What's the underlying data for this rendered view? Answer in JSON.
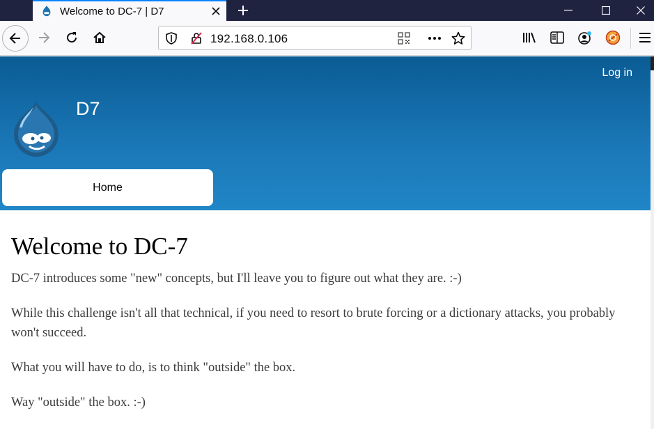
{
  "browser": {
    "tab": {
      "title": "Welcome to DC-7 | D7"
    },
    "url": "192.168.0.106",
    "icons": {
      "back": "arrow-left-icon",
      "forward": "arrow-right-icon",
      "reload": "reload-icon",
      "home": "home-icon",
      "shield": "shield-icon",
      "insecure": "insecure-lock-icon",
      "qr": "qr-code-icon",
      "page_actions": "ellipsis-icon",
      "bookmark": "star-icon",
      "library": "library-icon",
      "sidebar": "sidebar-icon",
      "account": "account-icon",
      "extension": "extension-icon",
      "menu": "hamburger-icon"
    },
    "colors": {
      "tabstrip": "#202340",
      "accent": "#0a84ff"
    }
  },
  "site": {
    "name": "D7",
    "login_label": "Log in",
    "nav": {
      "home_label": "Home"
    },
    "colors": {
      "header_top": "#0a5c94",
      "header_bottom": "#2086c6"
    }
  },
  "content": {
    "title": "Welcome to DC-7",
    "paragraphs": [
      "DC-7 introduces some \"new\" concepts, but I'll leave you to figure out what they are.  :-)",
      "While this challenge isn't all that technical, if you need to resort to brute forcing or a dictionary attacks, you probably won't succeed.",
      "What you will have to do, is to think \"outside\" the box.",
      "Way \"outside\" the box.  :-)"
    ]
  }
}
